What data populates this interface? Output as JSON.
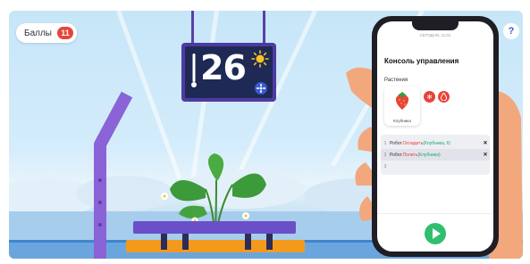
{
  "hud": {
    "points_label": "Баллы",
    "points_value": "11",
    "help_label": "?"
  },
  "greenhouse": {
    "temperature": "26",
    "weather_icon": "sun-icon",
    "fan_icon": "fan-icon"
  },
  "phone": {
    "status_bar": "СЕГОДНЯ, 11:01",
    "console_title": "Консоль управления",
    "plants_section": "Растения",
    "plant_name": "Клубника",
    "action_icons": [
      "snowflake-icon",
      "water-drop-icon"
    ],
    "code_lines": [
      {
        "num": "1",
        "object": "Робот.",
        "method": "Охладить",
        "arg": "(Клубника, 6)"
      },
      {
        "num": "2",
        "object": "Робот.",
        "method": "Полить",
        "arg": "(Клубника)"
      },
      {
        "num": "3",
        "object": "",
        "method": "",
        "arg": ""
      }
    ],
    "delete_label": "✕",
    "run_icon": "play-icon"
  },
  "colors": {
    "accent_red": "#e8443a",
    "accent_green": "#2fbf6d",
    "bed_purple": "#6b4fc9",
    "soil_orange": "#f39a1d"
  }
}
